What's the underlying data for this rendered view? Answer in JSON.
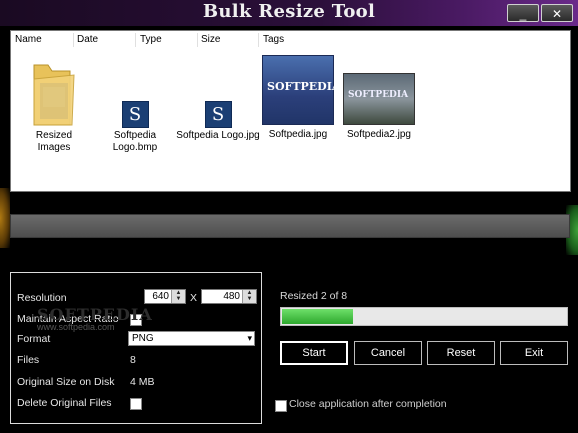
{
  "window": {
    "title": "Bulk Resize Tool",
    "minimize_label": "_",
    "close_label": "✕"
  },
  "columns": [
    "Name",
    "Date",
    "Type",
    "Size",
    "Tags"
  ],
  "files": [
    {
      "label": "Resized Images",
      "icon": "folder-icon"
    },
    {
      "label": "Softpedia Logo.bmp",
      "icon": "softpedia-logo-icon"
    },
    {
      "label": "Softpedia Logo.jpg",
      "icon": "softpedia-logo-icon"
    },
    {
      "label": "Softpedia.jpg",
      "icon": "image-thumbnail"
    },
    {
      "label": "Softpedia2.jpg",
      "icon": "image-thumbnail"
    }
  ],
  "thumb_text": {
    "softpedia": "SOFTPEDIA",
    "softpedia2": "SOFTPEDIA"
  },
  "settings": {
    "resolution_label": "Resolution",
    "width": "640",
    "separator": "X",
    "height": "480",
    "aspect_label": "Maintain Aspect Ratio",
    "aspect_checked": false,
    "format_label": "Format",
    "format_value": "PNG",
    "files_label": "Files",
    "files_value": "8",
    "original_size_label": "Original Size on Disk",
    "original_size_value": "4 MB",
    "delete_label": "Delete Original Files",
    "delete_checked": false
  },
  "watermark": {
    "text": "SOFTPEDIA",
    "sub": "www.softpedia.com"
  },
  "status": {
    "label": "Resized 2 of 8",
    "progress": 0.25
  },
  "actions": {
    "start": "Start",
    "cancel": "Cancel",
    "reset": "Reset",
    "exit": "Exit"
  },
  "close_after_label": "Close application after completion",
  "colors": {
    "accent_green": "#2ea82e",
    "title_bar": "#2b0f3a"
  }
}
